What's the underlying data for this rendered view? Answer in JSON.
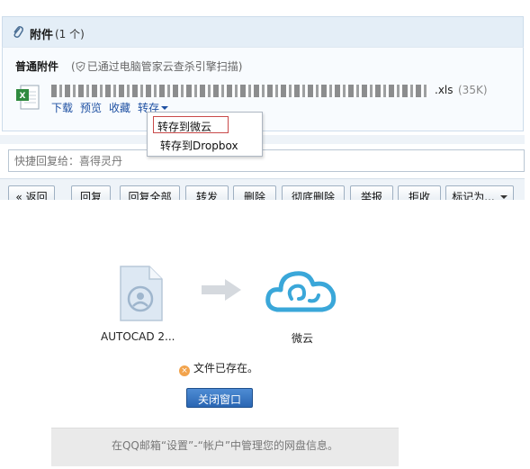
{
  "attachment": {
    "title": "附件",
    "count": "(1 个)",
    "section_title": "普通附件",
    "scan_note": "已通过电脑管家云查杀引擎扫描)",
    "scan_prefix": "(",
    "file_ext": ".xls",
    "file_size": "(35K)",
    "actions": {
      "download": "下载",
      "preview": "预览",
      "favorite": "收藏",
      "save_to": "转存"
    }
  },
  "dropdown": {
    "item_weiyun": "转存到微云",
    "item_dropbox": "转存到Dropbox"
  },
  "quick_reply": {
    "placeholder": "快捷回复给：喜得灵丹"
  },
  "toolbar": {
    "back": "« 返回",
    "reply": "回复",
    "reply_all": "回复全部",
    "forward": "转发",
    "delete": "删除",
    "delete_forever": "彻底删除",
    "report": "举报",
    "reject": "拒收",
    "mark_as": "标记为..."
  },
  "dialog": {
    "source_name": "AUTOCAD 2...",
    "target_name": "微云",
    "status": "文件已存在。",
    "close_button": "关闭窗口",
    "footer": "在QQ邮箱“设置”-“帐户”中管理您的网盘信息。"
  },
  "colors": {
    "link_blue": "#1e50a2",
    "header_bg": "#e4eef7",
    "button_blue": "#2a66b3",
    "cloud_blue": "#3aa7d9",
    "warning_orange": "#f2a34c"
  },
  "icons": {
    "attachment": "paperclip-icon",
    "scan": "shield-icon",
    "file": "excel-file-icon",
    "source": "document-icon",
    "arrow": "arrow-right-icon",
    "target": "weiyun-cloud-icon",
    "status": "warning-icon"
  }
}
